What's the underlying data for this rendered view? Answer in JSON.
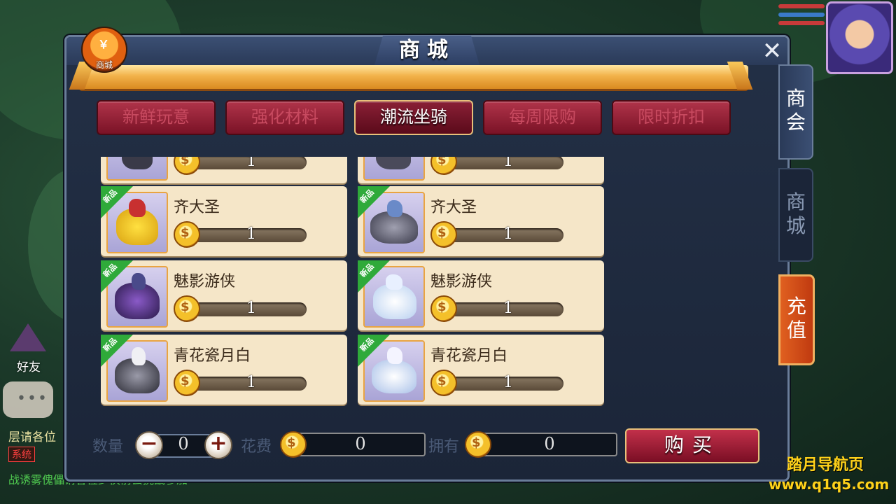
{
  "shop": {
    "title": "商城",
    "badge_label": "商城",
    "badge_symbol": "￥",
    "close_symbol": "✕"
  },
  "tabs": [
    {
      "label": "新鲜玩意",
      "active": false
    },
    {
      "label": "强化材料",
      "active": false
    },
    {
      "label": "潮流坐骑",
      "active": true
    },
    {
      "label": "每周限购",
      "active": false
    },
    {
      "label": "限时折扣",
      "active": false
    }
  ],
  "side_tabs": {
    "guild": "商会",
    "shop": "商城",
    "recharge": "充值"
  },
  "items": [
    {
      "name": "",
      "price": "1",
      "badge": ""
    },
    {
      "name": "",
      "price": "1",
      "badge": ""
    },
    {
      "name": "齐大圣",
      "price": "1",
      "badge": "新品"
    },
    {
      "name": "齐大圣",
      "price": "1",
      "badge": "新品"
    },
    {
      "name": "魅影游侠",
      "price": "1",
      "badge": "新品"
    },
    {
      "name": "魅影游侠",
      "price": "1",
      "badge": "新品"
    },
    {
      "name": "青花瓷月白",
      "price": "1",
      "badge": "新品"
    },
    {
      "name": "青花瓷月白",
      "price": "1",
      "badge": "新品"
    }
  ],
  "purchase": {
    "quantity_label": "数量",
    "quantity_value": "0",
    "minus": "−",
    "plus": "+",
    "cost_label": "花费",
    "cost_value": "0",
    "owned_label": "拥有",
    "owned_value": "0",
    "buy_label": "购买"
  },
  "left_hud": {
    "friend_label": "好友",
    "chat_dots": "•••",
    "chat_line1": "层请各位",
    "system_tag": "系统",
    "chat_line2": "战诱雾傀儡请各位少侠前去挑战参加"
  },
  "watermark": {
    "line1": "踏月导航页",
    "line2": "www.q1q5.com"
  },
  "colors": {
    "panel_bg": "#1b2538",
    "tab_red": "#7a1226",
    "card_bg": "#f5e6c8",
    "new_ribbon": "#2faa3a",
    "accent_gold": "#e7c07a"
  }
}
